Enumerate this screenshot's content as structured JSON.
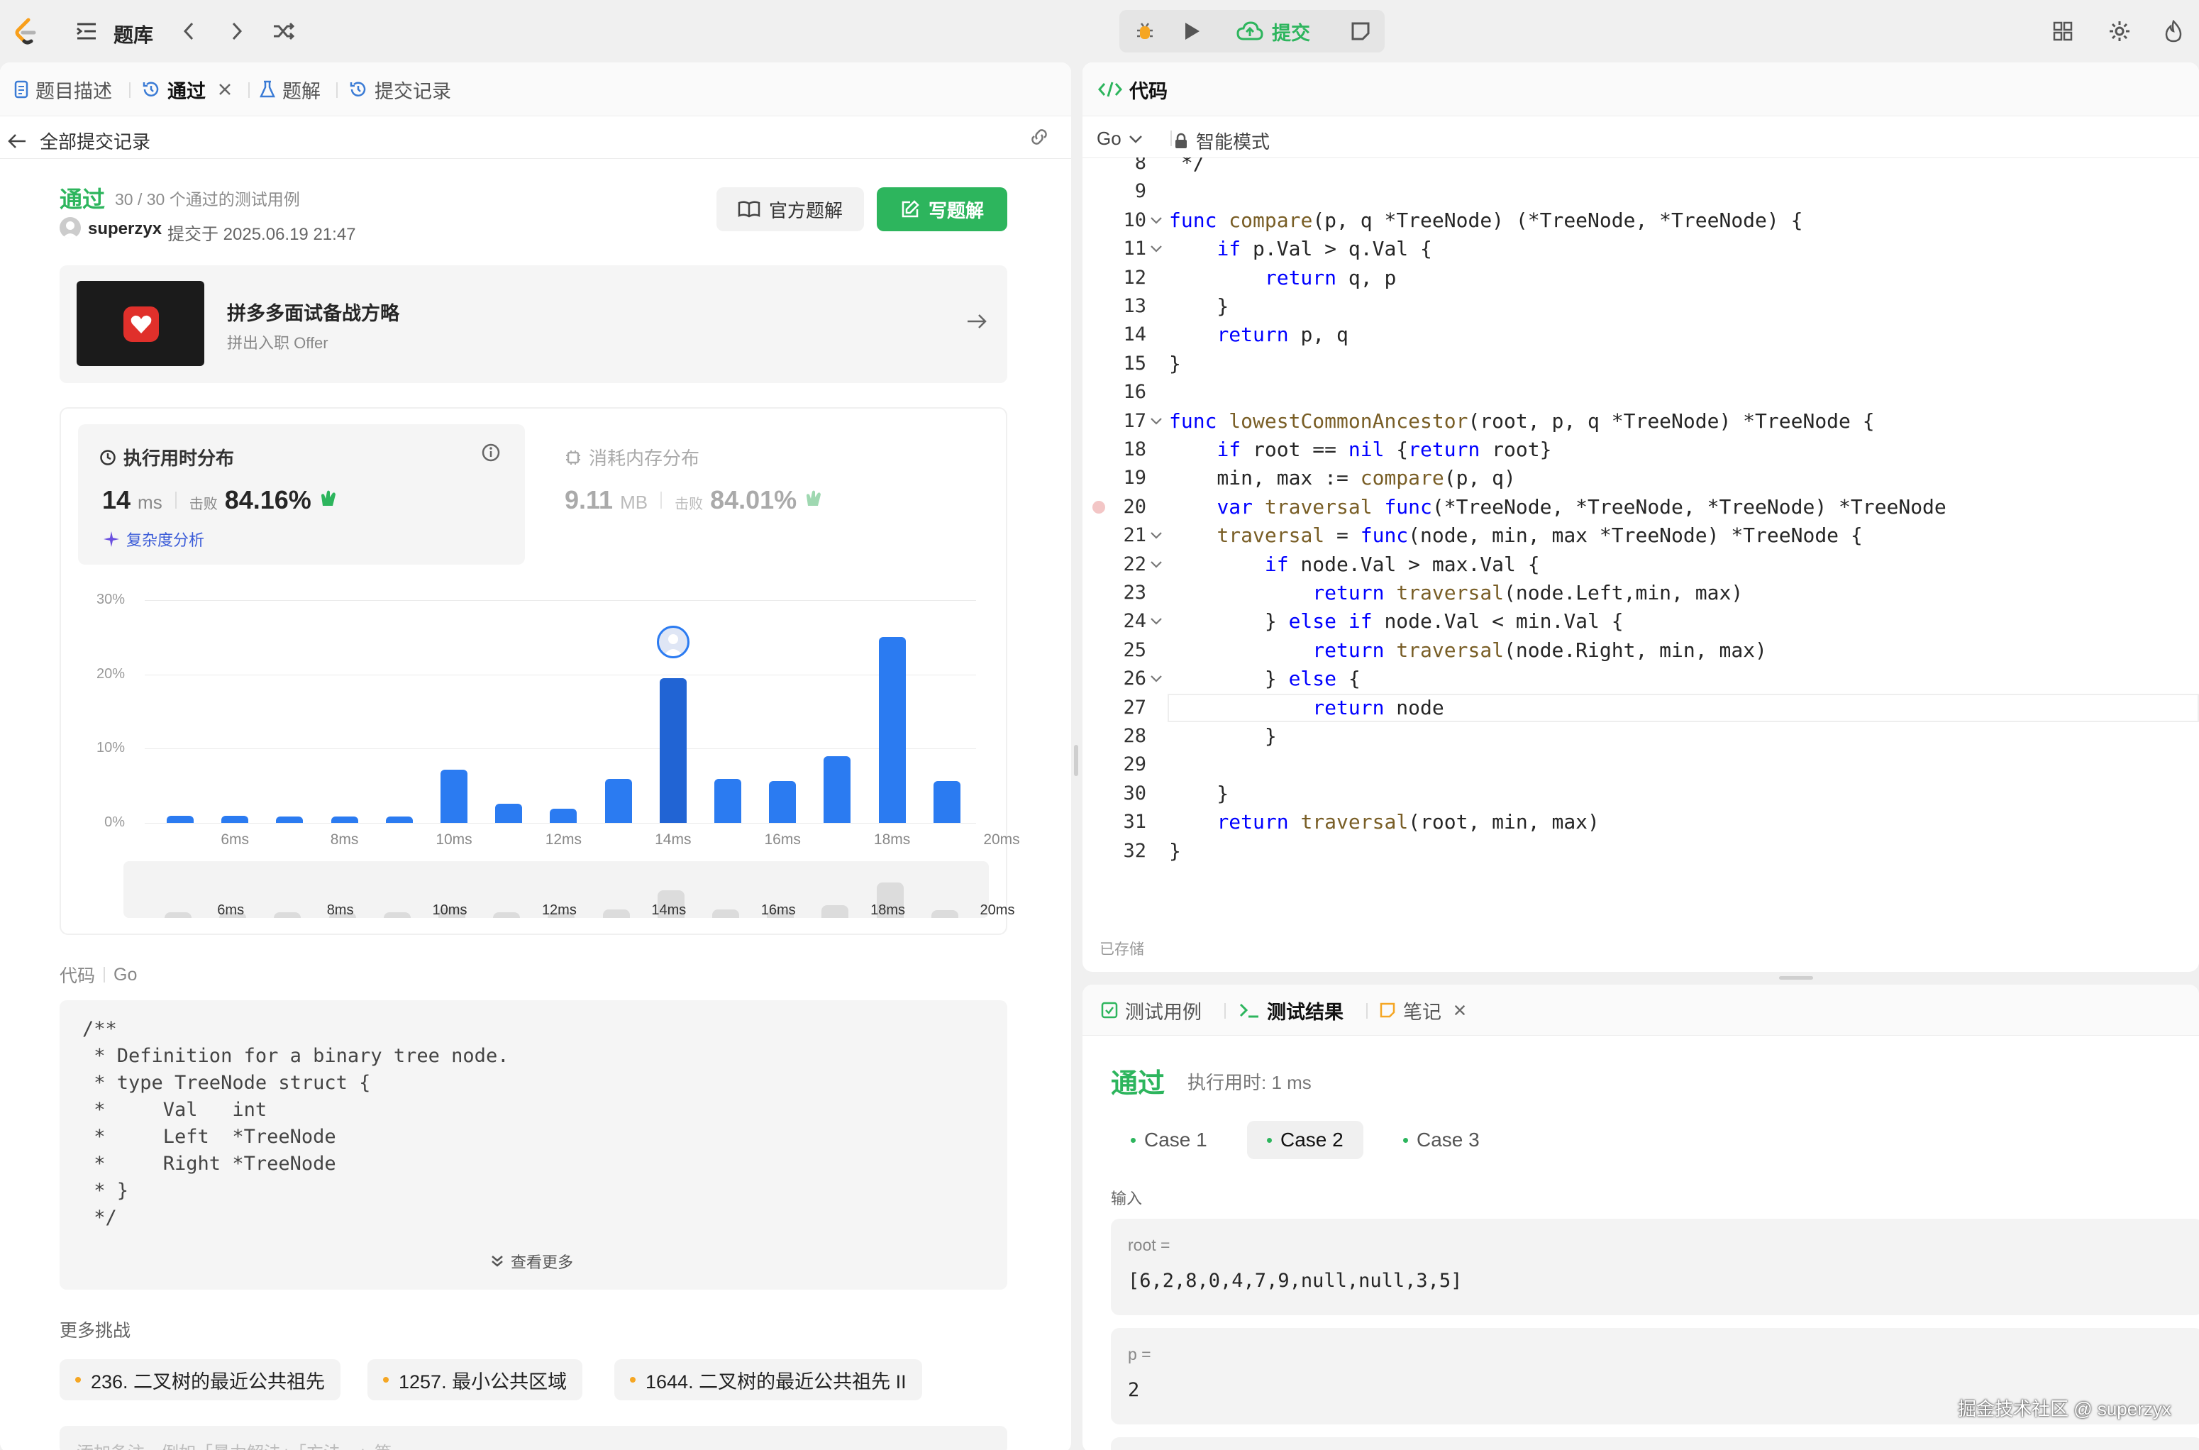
{
  "topbar": {
    "library_label": "题库",
    "submit_label": "提交"
  },
  "left": {
    "tabs": [
      {
        "label": "题目描述"
      },
      {
        "label": "通过"
      },
      {
        "label": "题解"
      },
      {
        "label": "提交记录"
      }
    ],
    "back_label": "全部提交记录",
    "status": "通过",
    "testcases": "30 / 30 个通过的测试用例",
    "user": "superzyx",
    "submitted_at": "提交于 2025.06.19 21:47",
    "official_btn": "官方题解",
    "write_btn": "写题解",
    "promo": {
      "title": "拼多多面试备战方略",
      "subtitle": "拼出入职 Offer"
    },
    "runtime": {
      "title": "执行用时分布",
      "value": "14",
      "unit": "ms",
      "beats_label": "击败",
      "beats": "84.16%",
      "analysis_link": "复杂度分析"
    },
    "memory": {
      "title": "消耗内存分布",
      "value": "9.11",
      "unit": "MB",
      "beats_label": "击败",
      "beats": "84.01%"
    },
    "code_header": {
      "label": "代码",
      "lang": "Go"
    },
    "code_snippet": [
      "/**",
      " * Definition for a binary tree node.",
      " * type TreeNode struct {",
      " *     Val   int",
      " *     Left  *TreeNode",
      " *     Right *TreeNode",
      " * }",
      " */"
    ],
    "show_more": "查看更多",
    "more_title": "更多挑战",
    "challenges": [
      {
        "label": "236. 二叉树的最近公共祖先"
      },
      {
        "label": "1257. 最小公共区域"
      },
      {
        "label": "1644. 二叉树的最近公共祖先 II"
      }
    ],
    "note_placeholder": "添加备注，例如「暴力解法」「方法一」等"
  },
  "chart_data": {
    "type": "bar",
    "title": "执行用时分布",
    "ylim": [
      0,
      30
    ],
    "yticks": [
      "0%",
      "10%",
      "20%",
      "30%"
    ],
    "xticks": [
      "6ms",
      "8ms",
      "10ms",
      "12ms",
      "14ms",
      "16ms",
      "18ms",
      "20ms"
    ],
    "x": [
      5,
      6,
      7,
      8,
      9,
      10,
      11,
      12,
      13,
      14,
      15,
      16,
      17,
      18,
      19,
      20
    ],
    "values": [
      1.0,
      1.0,
      0.9,
      0.9,
      0.9,
      7.2,
      2.6,
      1.9,
      5.9,
      19.5,
      5.9,
      5.6,
      9.0,
      25.0,
      5.6,
      0
    ],
    "user_value_x": 14,
    "grid": true
  },
  "minimap": {
    "labels": [
      "6ms",
      "8ms",
      "10ms",
      "12ms",
      "14ms",
      "16ms",
      "18ms",
      "20ms"
    ]
  },
  "editor": {
    "title": "代码",
    "lang": "Go",
    "mode": "智能模式",
    "saved": "已存储",
    "lines": [
      {
        "n": "8",
        "text": " */"
      },
      {
        "n": "9",
        "text": ""
      },
      {
        "n": "10",
        "text": "func compare(p, q *TreeNode) (*TreeNode, *TreeNode) {"
      },
      {
        "n": "11",
        "text": "    if p.Val > q.Val {"
      },
      {
        "n": "12",
        "text": "        return q, p"
      },
      {
        "n": "13",
        "text": "    }"
      },
      {
        "n": "14",
        "text": "    return p, q"
      },
      {
        "n": "15",
        "text": "}"
      },
      {
        "n": "16",
        "text": ""
      },
      {
        "n": "17",
        "text": "func lowestCommonAncestor(root, p, q *TreeNode) *TreeNode {"
      },
      {
        "n": "18",
        "text": "    if root == nil {return root}"
      },
      {
        "n": "19",
        "text": "    min, max := compare(p, q)"
      },
      {
        "n": "20",
        "text": "    var traversal func(*TreeNode, *TreeNode, *TreeNode) *TreeNode"
      },
      {
        "n": "21",
        "text": "    traversal = func(node, min, max *TreeNode) *TreeNode {"
      },
      {
        "n": "22",
        "text": "        if node.Val > max.Val {"
      },
      {
        "n": "23",
        "text": "            return traversal(node.Left,min, max)"
      },
      {
        "n": "24",
        "text": "        } else if node.Val < min.Val {"
      },
      {
        "n": "25",
        "text": "            return traversal(node.Right, min, max)"
      },
      {
        "n": "26",
        "text": "        } else {"
      },
      {
        "n": "27",
        "text": "            return node"
      },
      {
        "n": "28",
        "text": "        }"
      },
      {
        "n": "29",
        "text": ""
      },
      {
        "n": "30",
        "text": "    }"
      },
      {
        "n": "31",
        "text": "    return traversal(root, min, max)"
      },
      {
        "n": "32",
        "text": "}"
      }
    ]
  },
  "result": {
    "tabs": [
      {
        "label": "测试用例"
      },
      {
        "label": "测试结果"
      },
      {
        "label": "笔记"
      }
    ],
    "status": "通过",
    "runtime": "执行用时: 1 ms",
    "cases": [
      {
        "label": "Case 1"
      },
      {
        "label": "Case 2"
      },
      {
        "label": "Case 3"
      }
    ],
    "input_label": "输入",
    "inputs": [
      {
        "name": "root =",
        "value": "[6,2,8,0,4,7,9,null,null,3,5]"
      },
      {
        "name": "p =",
        "value": "2"
      }
    ]
  },
  "watermark": "掘金技术社区 @ superzyx",
  "colors": {
    "accent_green": "#2db55d",
    "bar_blue": "#2b7bf1",
    "keyword_blue": "#0000ff"
  }
}
